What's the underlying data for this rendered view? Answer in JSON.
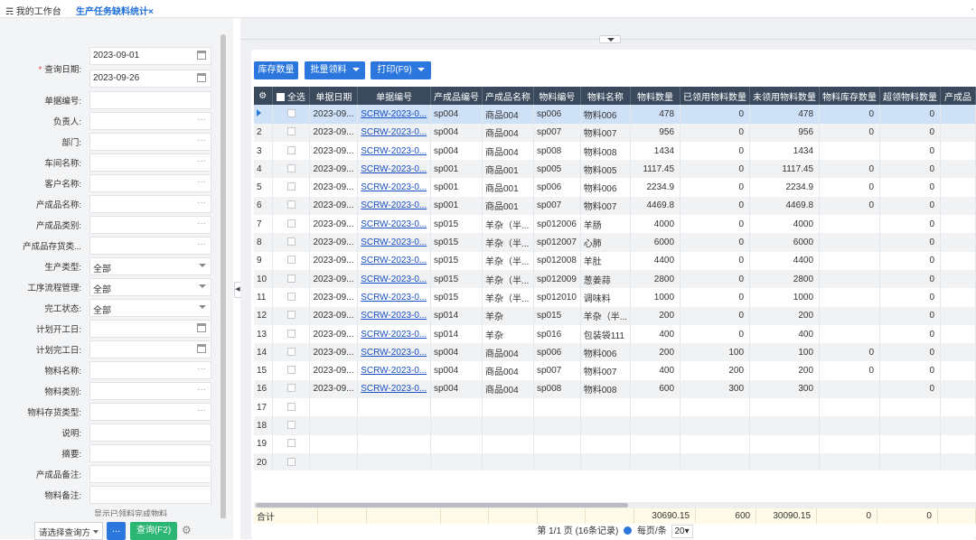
{
  "tabs": {
    "home": "我的工作台",
    "active": "生产任务缺料统计"
  },
  "filters": [
    {
      "label": "单据编号:",
      "value": "",
      "suffix": ""
    },
    {
      "label": "负责人:",
      "value": "",
      "suffix": "···"
    },
    {
      "label": "部门:",
      "value": "",
      "suffix": "···"
    },
    {
      "label": "车间名称:",
      "value": "",
      "suffix": "···"
    },
    {
      "label": "客户名称:",
      "value": "",
      "suffix": "···"
    },
    {
      "label": "产成品名称:",
      "value": "",
      "suffix": "···"
    },
    {
      "label": "产成品类别:",
      "value": "",
      "suffix": "···"
    },
    {
      "label": "产成品存货类...",
      "value": "",
      "suffix": "···"
    },
    {
      "label": "生产类型:",
      "value": "全部",
      "suffix": "arrow"
    },
    {
      "label": "工序流程管理:",
      "value": "全部",
      "suffix": "arrow"
    },
    {
      "label": "完工状态:",
      "value": "全部",
      "suffix": "arrow"
    },
    {
      "label": "计划开工日:",
      "value": "",
      "suffix": "cal"
    },
    {
      "label": "计划完工日:",
      "value": "",
      "suffix": "cal"
    },
    {
      "label": "物料名称:",
      "value": "",
      "suffix": "···"
    },
    {
      "label": "物料类别:",
      "value": "",
      "suffix": "···"
    },
    {
      "label": "物料存货类型:",
      "value": "",
      "suffix": "···"
    },
    {
      "label": "说明:",
      "value": "",
      "suffix": ""
    },
    {
      "label": "摘要:",
      "value": "",
      "suffix": ""
    },
    {
      "label": "产成品备注:",
      "value": "",
      "suffix": ""
    },
    {
      "label": "物料备注:",
      "value": "",
      "suffix": ""
    }
  ],
  "query_date": {
    "label": "查询日期:",
    "start": "2023-09-01",
    "end": "2023-09-26"
  },
  "left_cutoff_text": "显示已领料完成物料",
  "bottom": {
    "scheme": "请选择查询方",
    "dots": "...",
    "query": "查询(F2)"
  },
  "toolbar": {
    "stock": "库存数量",
    "batch": "批量领料",
    "print": "打印(F9)"
  },
  "columns": [
    "全选",
    "单据日期",
    "单据编号",
    "产成品编号",
    "产成品名称",
    "物料编号",
    "物料名称",
    "物料数量",
    "已领用物料数量",
    "未领用物料数量",
    "物料库存数量",
    "超领物料数量",
    "产成品"
  ],
  "rows": [
    [
      "1",
      "2023-09...",
      "SCRW-2023-0...",
      "sp004",
      "商品004",
      "sp006",
      "物料006",
      "478",
      "0",
      "478",
      "0",
      "0"
    ],
    [
      "2",
      "2023-09...",
      "SCRW-2023-0...",
      "sp004",
      "商品004",
      "sp007",
      "物料007",
      "956",
      "0",
      "956",
      "0",
      "0"
    ],
    [
      "3",
      "2023-09...",
      "SCRW-2023-0...",
      "sp004",
      "商品004",
      "sp008",
      "物料008",
      "1434",
      "0",
      "1434",
      "",
      "0"
    ],
    [
      "4",
      "2023-09...",
      "SCRW-2023-0...",
      "sp001",
      "商品001",
      "sp005",
      "物料005",
      "1117.45",
      "0",
      "1117.45",
      "0",
      "0"
    ],
    [
      "5",
      "2023-09...",
      "SCRW-2023-0...",
      "sp001",
      "商品001",
      "sp006",
      "物料006",
      "2234.9",
      "0",
      "2234.9",
      "0",
      "0"
    ],
    [
      "6",
      "2023-09...",
      "SCRW-2023-0...",
      "sp001",
      "商品001",
      "sp007",
      "物料007",
      "4469.8",
      "0",
      "4469.8",
      "0",
      "0"
    ],
    [
      "7",
      "2023-09...",
      "SCRW-2023-0...",
      "sp015",
      "羊杂（半...",
      "sp012006",
      "羊肠",
      "4000",
      "0",
      "4000",
      "",
      "0"
    ],
    [
      "8",
      "2023-09...",
      "SCRW-2023-0...",
      "sp015",
      "羊杂（半...",
      "sp012007",
      "心肺",
      "6000",
      "0",
      "6000",
      "",
      "0"
    ],
    [
      "9",
      "2023-09...",
      "SCRW-2023-0...",
      "sp015",
      "羊杂（半...",
      "sp012008",
      "羊肚",
      "4400",
      "0",
      "4400",
      "",
      "0"
    ],
    [
      "10",
      "2023-09...",
      "SCRW-2023-0...",
      "sp015",
      "羊杂（半...",
      "sp012009",
      "葱姜蒜",
      "2800",
      "0",
      "2800",
      "",
      "0"
    ],
    [
      "11",
      "2023-09...",
      "SCRW-2023-0...",
      "sp015",
      "羊杂（半...",
      "sp012010",
      "调味料",
      "1000",
      "0",
      "1000",
      "",
      "0"
    ],
    [
      "12",
      "2023-09...",
      "SCRW-2023-0...",
      "sp014",
      "羊杂",
      "sp015",
      "羊杂（半...",
      "200",
      "0",
      "200",
      "",
      "0"
    ],
    [
      "13",
      "2023-09...",
      "SCRW-2023-0...",
      "sp014",
      "羊杂",
      "sp016",
      "包装袋111",
      "400",
      "0",
      "400",
      "",
      "0"
    ],
    [
      "14",
      "2023-09...",
      "SCRW-2023-0...",
      "sp004",
      "商品004",
      "sp006",
      "物料006",
      "200",
      "100",
      "100",
      "0",
      "0"
    ],
    [
      "15",
      "2023-09...",
      "SCRW-2023-0...",
      "sp004",
      "商品004",
      "sp007",
      "物料007",
      "400",
      "200",
      "200",
      "0",
      "0"
    ],
    [
      "16",
      "2023-09...",
      "SCRW-2023-0...",
      "sp004",
      "商品004",
      "sp008",
      "物料008",
      "600",
      "300",
      "300",
      "",
      "0"
    ],
    [
      "17",
      "",
      "",
      "",
      "",
      "",
      "",
      "",
      "",
      "",
      "",
      ""
    ],
    [
      "18",
      "",
      "",
      "",
      "",
      "",
      "",
      "",
      "",
      "",
      "",
      ""
    ],
    [
      "19",
      "",
      "",
      "",
      "",
      "",
      "",
      "",
      "",
      "",
      "",
      ""
    ],
    [
      "20",
      "",
      "",
      "",
      "",
      "",
      "",
      "",
      "",
      "",
      "",
      ""
    ]
  ],
  "totals": {
    "label": "合计",
    "qty": "30690.15",
    "used": "600",
    "unused": "30090.15",
    "stock": "0",
    "over": "0"
  },
  "pager": {
    "info": "第 1/1 页 (16条记录)",
    "per_page": "每页/条",
    "size": "20"
  }
}
